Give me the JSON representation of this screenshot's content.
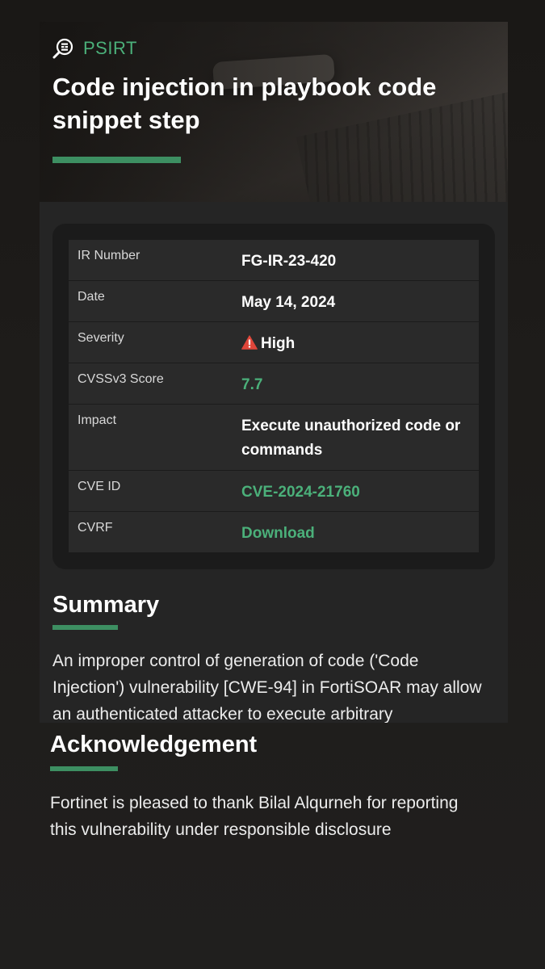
{
  "hero": {
    "category": "PSIRT",
    "title": "Code injection in playbook code snippet step"
  },
  "colors": {
    "accent": "#4bb07a",
    "warning": "#e0463a",
    "card": "#252525"
  },
  "info": {
    "rows": [
      {
        "label": "IR Number",
        "value": "FG-IR-23-420"
      },
      {
        "label": "Date",
        "value": "May 14, 2024"
      },
      {
        "label": "Severity",
        "value": "High",
        "icon": "warning-icon"
      },
      {
        "label": "CVSSv3 Score",
        "value": "7.7"
      },
      {
        "label": "Impact",
        "value": "Execute unauthorized code or commands"
      },
      {
        "label": "CVE ID",
        "value": "CVE-2024-21760"
      },
      {
        "label": "CVRF",
        "value": "Download"
      }
    ]
  },
  "summary": {
    "title": "Summary",
    "text": "An improper control of generation of code ('Code Injection') vulnerability [CWE-94] in FortiSOAR may allow an authenticated attacker to execute arbitrary"
  },
  "acknowledgement": {
    "title": "Acknowledgement",
    "text": "Fortinet is pleased to thank Bilal Alqurneh for reporting this vulnerability under responsible disclosure"
  }
}
